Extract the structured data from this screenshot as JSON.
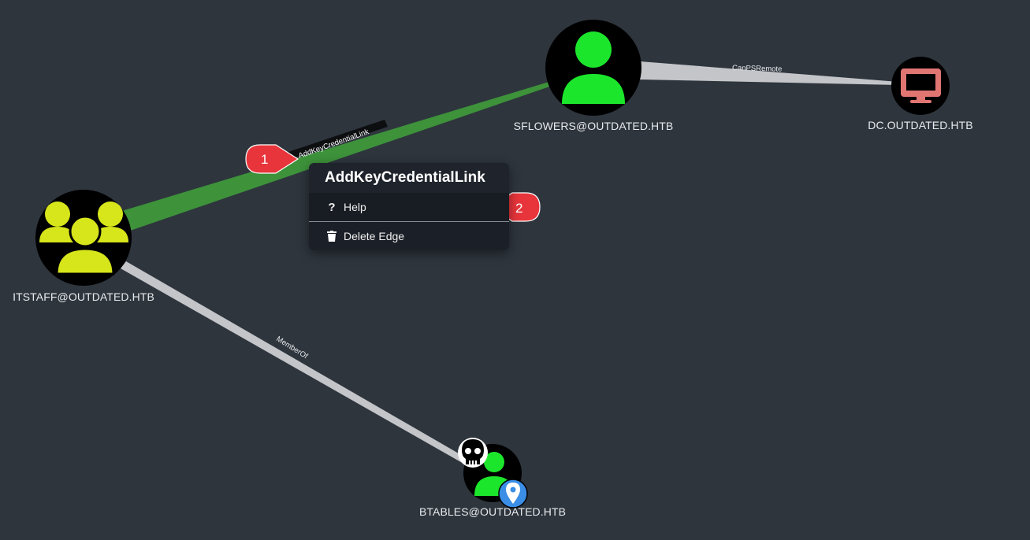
{
  "nodes": {
    "itstaff": {
      "label": "ITSTAFF@OUTDATED.HTB",
      "icon": "group-icon",
      "color": "#d7e51b"
    },
    "sflowers": {
      "label": "SFLOWERS@OUTDATED.HTB",
      "icon": "user-icon",
      "color": "#1ce62c"
    },
    "dc": {
      "label": "DC.OUTDATED.HTB",
      "icon": "computer-icon",
      "color": "#e07572"
    },
    "btables": {
      "label": "BTABLES@OUTDATED.HTB",
      "icon": "user-icon",
      "color": "#1ce62c",
      "badges": [
        "skull-icon",
        "location-pin-icon"
      ]
    }
  },
  "edges": {
    "addkeycredentiallink": {
      "label": "AddKeyCredentialLink",
      "color": "#3fa33d"
    },
    "canpsremote": {
      "label": "CanPSRemote",
      "color": "#c3c5c9"
    },
    "memberof": {
      "label": "MemberOf",
      "color": "#c3c5c9"
    }
  },
  "context_menu": {
    "title": "AddKeyCredentialLink",
    "items": [
      {
        "label": "Help",
        "icon": "question-icon"
      },
      {
        "label": "Delete Edge",
        "icon": "trash-icon"
      }
    ]
  },
  "callouts": [
    {
      "number": "1",
      "color": "#e8353b"
    },
    {
      "number": "2",
      "color": "#e8353b"
    }
  ],
  "colors": {
    "background": "#2e353d",
    "menu_background": "#1b1f27",
    "node_circle": "#000000"
  }
}
